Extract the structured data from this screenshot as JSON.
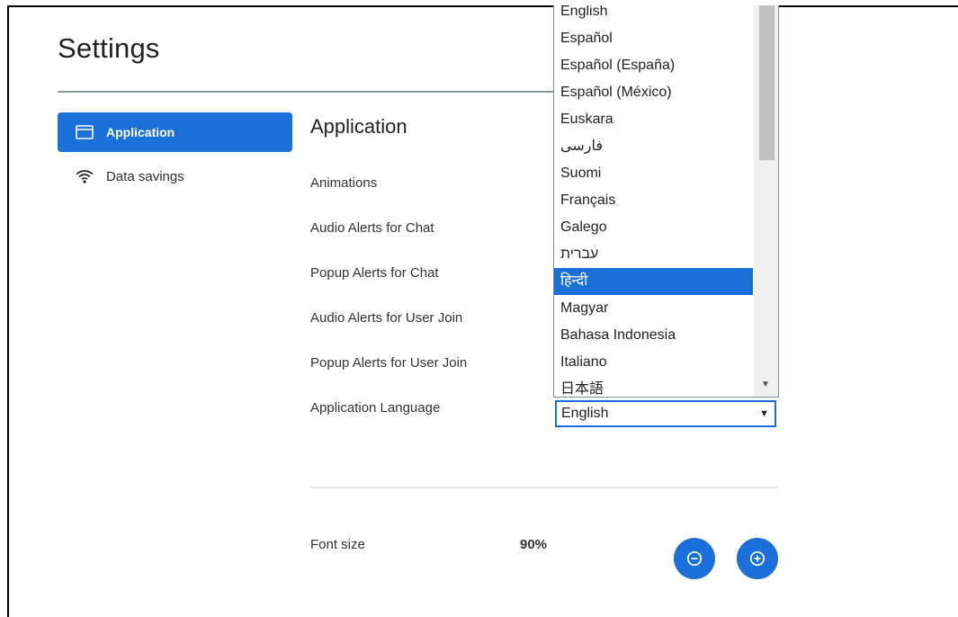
{
  "page": {
    "title": "Settings"
  },
  "sidebar": {
    "items": [
      {
        "label": "Application",
        "icon": "window-icon",
        "active": true
      },
      {
        "label": "Data savings",
        "icon": "wifi-icon",
        "active": false
      }
    ]
  },
  "main": {
    "section_title": "Application",
    "settings": [
      {
        "label": "Animations"
      },
      {
        "label": "Audio Alerts for Chat"
      },
      {
        "label": "Popup Alerts for Chat"
      },
      {
        "label": "Audio Alerts for User Join"
      },
      {
        "label": "Popup Alerts for User Join"
      },
      {
        "label": "Application Language"
      }
    ],
    "language_select": {
      "value": "English",
      "options": [
        "English",
        "Español",
        "Español (España)",
        "Español (México)",
        "Euskara",
        "فارسی",
        "Suomi",
        "Français",
        "Galego",
        "עברית",
        "हिन्दी",
        "Magyar",
        "Bahasa Indonesia",
        "Italiano",
        "日本語"
      ],
      "highlighted": "हिन्दी"
    },
    "font_size": {
      "label": "Font size",
      "value": "90%",
      "decrease_icon": "minus-circle-icon",
      "increase_icon": "plus-circle-icon"
    }
  },
  "colors": {
    "accent": "#1b6fd9",
    "title_rule": "#8a95a3",
    "divider": "#e7e7e7"
  }
}
